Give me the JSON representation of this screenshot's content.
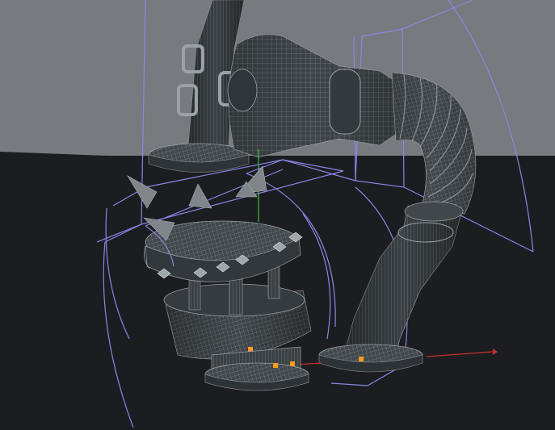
{
  "viewport": {
    "label": "3d-viewport-perspective",
    "colors": {
      "sky": "#777a7e",
      "floor": "#1b1d20",
      "mesh_fill": "#3f4549",
      "mesh_dark": "#2d3236",
      "wire": "#9aa2a8",
      "cage": "#8c86e6",
      "axis_y": "#3fbf3f",
      "axis_x": "#c43030",
      "selected_point": "#ff9a1f",
      "spike": "#7f8589"
    },
    "objects": [
      "robot-arm-upper-pipe",
      "robot-arm-elbow-joint",
      "segmented-hose",
      "lower-leg-tube",
      "spiked-ring-collar",
      "wrist-joint-cylinder",
      "foot-base",
      "ankle-base",
      "floating-spikes",
      "deformer-cage"
    ]
  }
}
